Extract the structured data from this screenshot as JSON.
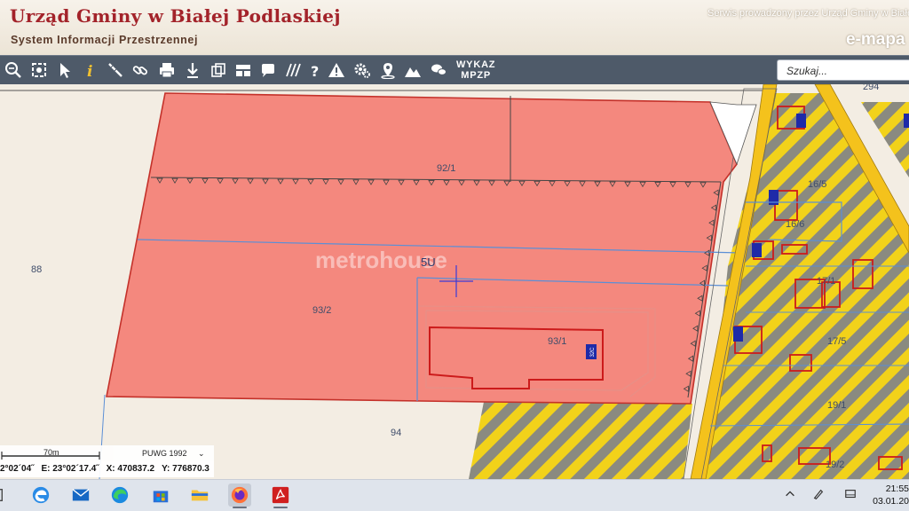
{
  "header": {
    "title": "Urząd Gminy w Białej Podlaskiej",
    "subtitle": "System Informacji Przestrzennej",
    "service_note": "Serwis prowadzony przez Urząd Gminy w Białej",
    "brand": "e-mapa"
  },
  "toolbar": {
    "tools": [
      "zoom-icon",
      "zoom-extent-icon",
      "pointer-icon",
      "info-icon",
      "measure-icon",
      "link-icon",
      "print-icon",
      "download-icon",
      "layers-icon",
      "layout-icon",
      "comment-icon",
      "hatch-icon",
      "help-icon",
      "warning-icon",
      "settings-icon",
      "location-icon",
      "terrain-icon",
      "chat-icon"
    ],
    "wykaz_line1": "WYKAZ",
    "wykaz_line2": "MPZP",
    "search_placeholder": "Szukaj..."
  },
  "map": {
    "parcel_labels": [
      "88",
      "92/1",
      "93/2",
      "93/1",
      "94",
      "5U",
      "294",
      "16/5",
      "16/6",
      "17/1",
      "17/5",
      "19/1",
      "19/2"
    ],
    "building_tags": [
      "32C",
      "9B",
      "16B",
      "17B",
      "14B"
    ],
    "watermark": "metrohouse",
    "colors": {
      "zone_fill": "#f4887e",
      "zone_stroke": "#c4312a",
      "hatch_yellow": "#f2d21a",
      "hatch_gray": "#8a8a80",
      "road_yellow": "#f4c21c",
      "parcel_line": "#5b8fd6",
      "building": "#cc1b1b"
    }
  },
  "status": {
    "scale_label": "70m",
    "projection": "PUWG 1992",
    "projection_arrow": "⌄",
    "lat_fragment": "2°02´04˝",
    "lon_label": "E: 23°02´17.4˝",
    "x_label": "X: 470837.2",
    "y_label": "Y: 776870.3"
  },
  "taskbar": {
    "apps": [
      "start-icon",
      "edge-legacy-icon",
      "mail-icon",
      "edge-icon",
      "store-icon",
      "file-explorer-icon",
      "firefox-icon",
      "pdf-icon"
    ],
    "time": "21:55",
    "date": "03.01.20"
  }
}
